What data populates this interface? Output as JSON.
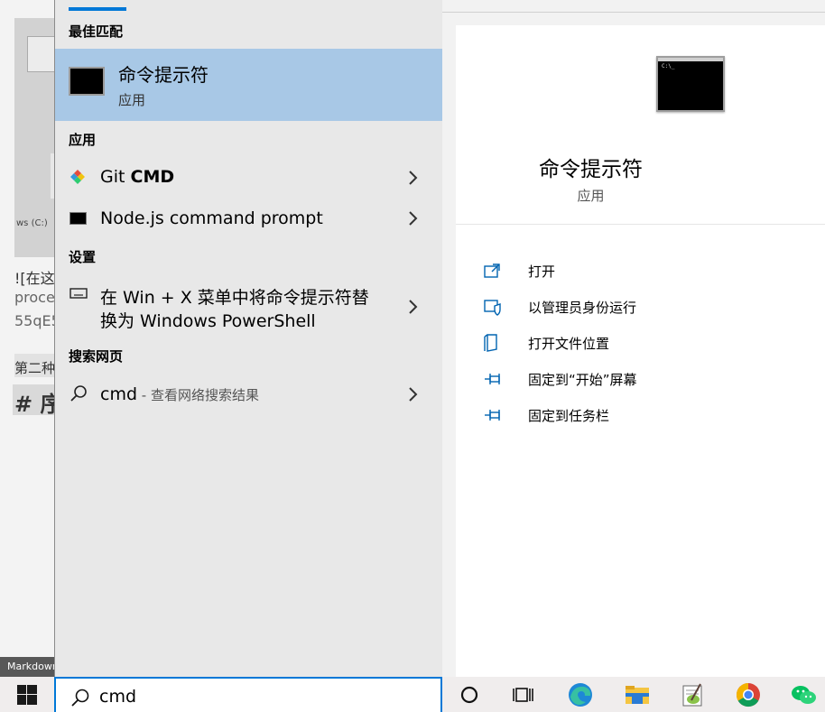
{
  "background_editor": {
    "drive_label": "ws (C:)",
    "line1": "![在这里",
    "line2": "proces",
    "line3": "55qE5",
    "line4": "第二种",
    "heading": "# 序",
    "status": "Markdown"
  },
  "search_panel": {
    "best_match_header": "最佳匹配",
    "best_match": {
      "title": "命令提示符",
      "subtitle": "应用",
      "icon": "cmd-icon"
    },
    "apps_header": "应用",
    "apps": [
      {
        "label_plain": "Git ",
        "label_bold": "CMD",
        "icon": "git-icon"
      },
      {
        "label_plain": "Node.js command prompt",
        "label_bold": "",
        "icon": "node-cmd-icon"
      }
    ],
    "settings_header": "设置",
    "settings": [
      {
        "line1": "在 Win + X 菜单中将命令提示符替",
        "line2": "换为 Windows PowerShell",
        "icon": "keyboard-icon"
      }
    ],
    "web_header": "搜索网页",
    "web": [
      {
        "query": "cmd",
        "suffix": " - 查看网络搜索结果",
        "icon": "search-icon"
      }
    ]
  },
  "preview": {
    "title": "命令提示符",
    "subtitle": "应用",
    "actions": [
      {
        "label": "打开",
        "icon": "open-icon"
      },
      {
        "label": "以管理员身份运行",
        "icon": "shield-icon"
      },
      {
        "label": "打开文件位置",
        "icon": "file-location-icon"
      },
      {
        "label": "固定到“开始”屏幕",
        "icon": "pin-icon"
      },
      {
        "label": "固定到任务栏",
        "icon": "pin-icon"
      }
    ]
  },
  "taskbar": {
    "search_value": "cmd",
    "icons": [
      "cortana-icon",
      "task-view-icon",
      "edge-icon",
      "file-explorer-icon",
      "notepad-plus-icon",
      "chrome-icon",
      "wechat-icon"
    ]
  },
  "colors": {
    "accent": "#0078d7",
    "selection": "#a8c8e6",
    "results_bg": "#e8e8e8"
  }
}
